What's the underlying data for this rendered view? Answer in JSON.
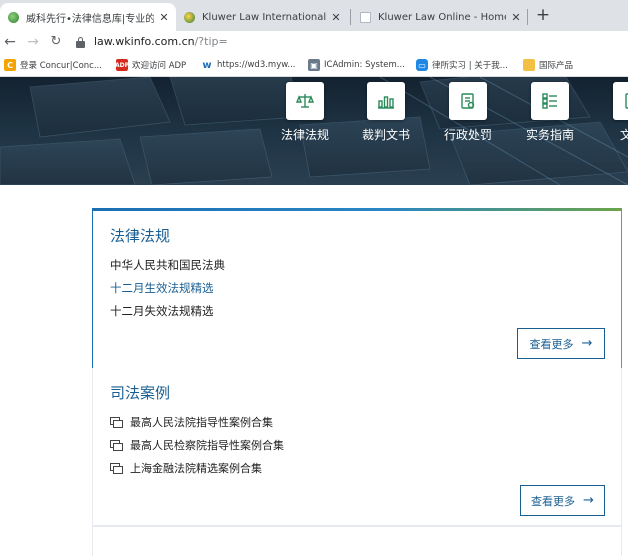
{
  "browser": {
    "tabs": [
      {
        "title": "威科先行•法律信息库|专业的中文",
        "active": true
      },
      {
        "title": "Kluwer Law International - Ho",
        "active": false
      },
      {
        "title": "Kluwer Law Online - Home",
        "active": false
      }
    ],
    "url_host": "law.wkinfo.com.cn",
    "url_path": "/?tip=",
    "bookmarks": [
      {
        "label": "登录 Concur|Conc...",
        "icon": "concur-icon",
        "color": "#f5a300"
      },
      {
        "label": "欢迎访问 ADP",
        "icon": "adp-icon",
        "color": "#d52b1e"
      },
      {
        "label": "https://wd3.myw...",
        "icon": "workday-icon",
        "color": "#1f6fb8"
      },
      {
        "label": "ICAdmin: System...",
        "icon": "icadmin-icon",
        "color": "#6b7a8a"
      },
      {
        "label": "律所实习 | 关于我...",
        "icon": "chat-icon",
        "color": "#1e88e5"
      },
      {
        "label": "国际产品",
        "icon": "folder-icon",
        "color": "#f3c044"
      }
    ]
  },
  "nav": {
    "items": [
      {
        "label": "法律法规",
        "icon": "scale-icon"
      },
      {
        "label": "裁判文书",
        "icon": "chart-icon"
      },
      {
        "label": "行政处罚",
        "icon": "document-icon"
      },
      {
        "label": "实务指南",
        "icon": "list-icon"
      },
      {
        "label": "文书",
        "icon": "file-icon"
      }
    ]
  },
  "laws": {
    "title": "法律法规",
    "items": [
      "中华人民共和国民法典",
      "十二月生效法规精选",
      "十二月失效法规精选"
    ],
    "more": "查看更多"
  },
  "cases": {
    "title": "司法案例",
    "items": [
      "最高人民法院指导性案例合集",
      "最高人民检察院指导性案例合集",
      "上海金融法院精选案例合集"
    ],
    "more": "查看更多"
  },
  "colors": {
    "brand": "#1a5f93",
    "accent_green": "#6ba44a",
    "hero_dark": "#1d3242"
  }
}
